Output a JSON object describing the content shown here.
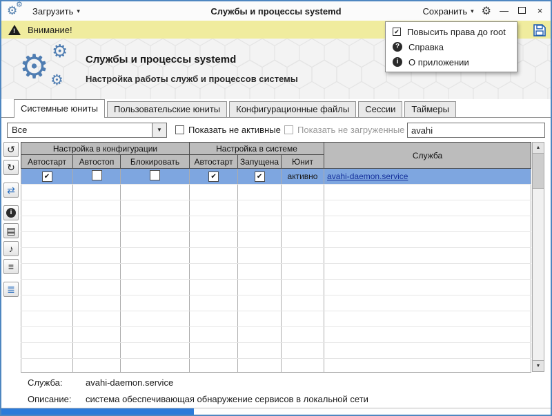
{
  "titlebar": {
    "load_label": "Загрузить",
    "title": "Службы и процессы systemd",
    "save_label": "Сохранить"
  },
  "warning": {
    "text": "Внимание!"
  },
  "menu": {
    "items": [
      {
        "label": "Повысить права до root"
      },
      {
        "label": "Справка"
      },
      {
        "label": "О приложении"
      }
    ]
  },
  "hero": {
    "title": "Службы и процессы systemd",
    "subtitle": "Настройка работы служб и процессов системы"
  },
  "tabs": [
    {
      "label": "Системные юниты",
      "active": true
    },
    {
      "label": "Пользовательские юниты",
      "active": false
    },
    {
      "label": "Конфигурационные файлы",
      "active": false
    },
    {
      "label": "Сессии",
      "active": false
    },
    {
      "label": "Таймеры",
      "active": false
    }
  ],
  "filters": {
    "unit_filter_value": "Все",
    "show_inactive_label": "Показать не активные",
    "show_unloaded_label": "Показать не загруженные",
    "search_value": "avahi"
  },
  "toolbar": [
    {
      "name": "history-button",
      "glyph": "↺"
    },
    {
      "name": "refresh-button",
      "glyph": "↻"
    },
    {
      "name": "sync-button",
      "glyph": "⇄"
    },
    {
      "name": "info-button",
      "glyph": "i"
    },
    {
      "name": "file-button",
      "glyph": "▤"
    },
    {
      "name": "journal-button",
      "glyph": "♪"
    },
    {
      "name": "log-button",
      "glyph": "≡"
    },
    {
      "name": "list-button",
      "glyph": "≣"
    }
  ],
  "table": {
    "groups": {
      "config": "Настройка в конфигурации",
      "system": "Настройка в системе",
      "service": "Служба"
    },
    "columns": [
      "Автостарт",
      "Автостоп",
      "Блокировать",
      "Автостарт",
      "Запущена",
      "Юнит"
    ],
    "row": {
      "checks": [
        "✔",
        "",
        "",
        "✔",
        "✔"
      ],
      "unit_state": "активно",
      "service": "avahi-daemon.service"
    }
  },
  "details": {
    "service_label": "Служба:",
    "service_value": "avahi-daemon.service",
    "description_label": "Описание:",
    "description_value": "система обеспечивающая обнаружение сервисов в локальной сети"
  },
  "progress": {
    "percent": 35
  },
  "icons": {
    "gear": "⚙",
    "caret_down": "▾",
    "combo_arrow": "▼",
    "check": "✔",
    "help": "?",
    "about": "i",
    "warning": "!",
    "minimize": "—",
    "close": "×",
    "scroll_up": "▲",
    "scroll_down": "▼"
  },
  "colors": {
    "window_border": "#4e86c0",
    "warning_bg": "#f0ec9e",
    "selection": "#7ea6e0",
    "accent_blue": "#2b6fc0",
    "link": "#16329c",
    "progress": "#2c7bd9"
  }
}
